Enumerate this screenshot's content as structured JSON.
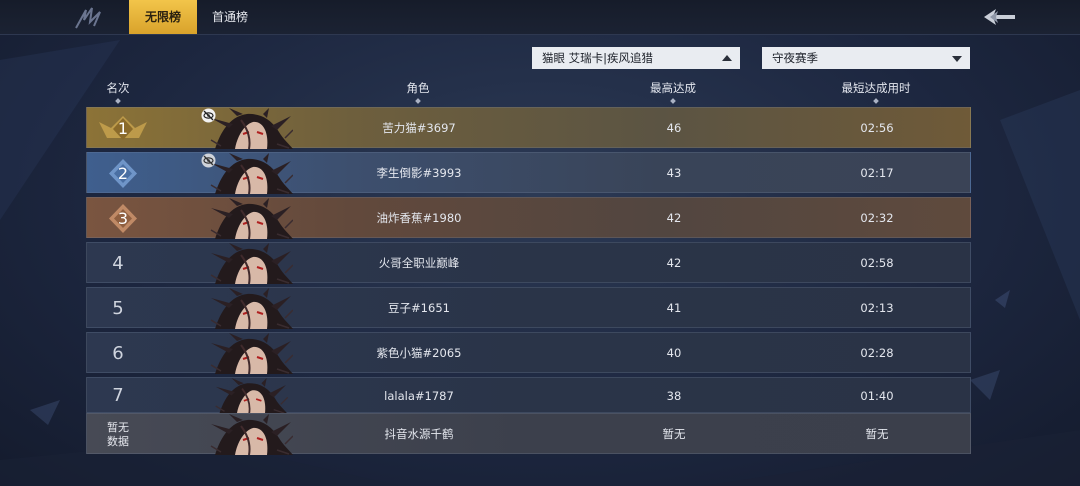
{
  "tabs": [
    {
      "label": "无限榜",
      "active": true
    },
    {
      "label": "首通榜",
      "active": false
    }
  ],
  "icons": {
    "logo": "game-logo-icon",
    "back": "back-arrow-icon",
    "eye": "eye-hidden-icon",
    "avatar": "character-avatar-icon"
  },
  "filters": {
    "character": "猫眼 艾瑞卡|疾风追猎",
    "season": "守夜赛季"
  },
  "columns": {
    "rank": "名次",
    "role": "角色",
    "best": "最高达成",
    "fastest": "最短达成用时"
  },
  "rows": [
    {
      "rank": "1",
      "name": "苦力猫#3697",
      "score": "46",
      "time": "02:56",
      "hidden": true
    },
    {
      "rank": "2",
      "name": "李生倒影#3993",
      "score": "43",
      "time": "02:17",
      "hidden": true
    },
    {
      "rank": "3",
      "name": "油炸香蕉#1980",
      "score": "42",
      "time": "02:32",
      "hidden": false
    },
    {
      "rank": "4",
      "name": "火哥全职业巅峰",
      "score": "42",
      "time": "02:58",
      "hidden": false
    },
    {
      "rank": "5",
      "name": "豆子#1651",
      "score": "41",
      "time": "02:13",
      "hidden": false
    },
    {
      "rank": "6",
      "name": "紫色小猫#2065",
      "score": "40",
      "time": "02:28",
      "hidden": false
    },
    {
      "rank": "7",
      "name": "lalala#1787",
      "score": "38",
      "time": "01:40",
      "hidden": false
    }
  ],
  "me": {
    "rank_line1": "暂无",
    "rank_line2": "数据",
    "name": "抖音水源千鹤",
    "score": "暂无",
    "time": "暂无"
  },
  "colors": {
    "gold_tab": "#f2c54a",
    "rank1": "#8c7337",
    "rank2": "#3f5f8e",
    "rank3": "#7a5540",
    "background": "#1d2740"
  }
}
